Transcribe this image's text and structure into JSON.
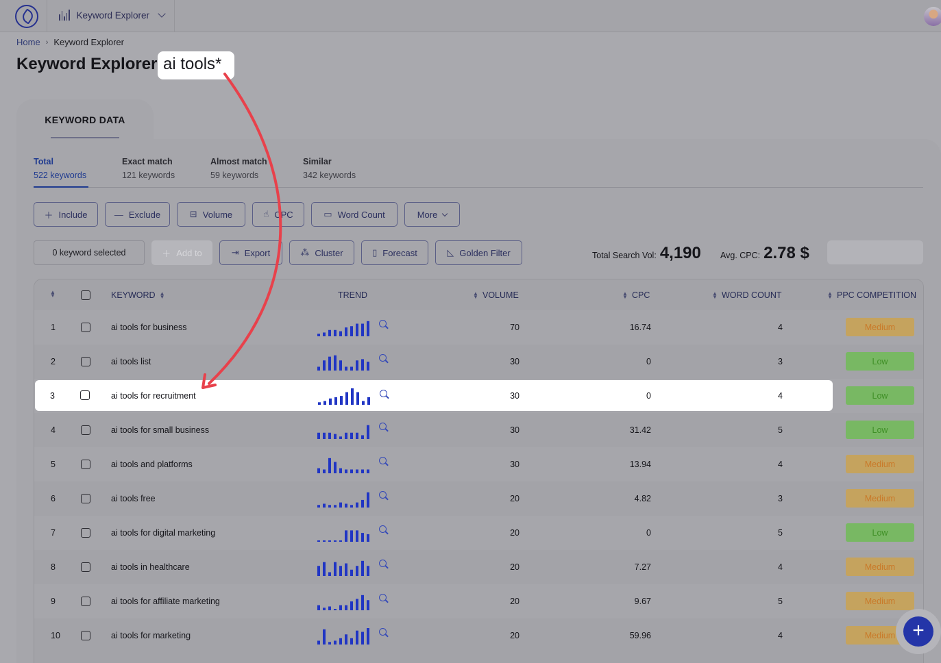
{
  "topbar": {
    "app_name": "Keyword Explorer",
    "icons": {
      "logo": "feather-pen-logo",
      "app": "bar-chart-icon",
      "dropdown": "chevron-down-icon",
      "avatar": "user-avatar"
    }
  },
  "breadcrumb": {
    "home": "Home",
    "separator": "›",
    "current": "Keyword Explorer"
  },
  "title": {
    "prefix": "Keyword Explorer:",
    "query": "ai tools*"
  },
  "panel": {
    "tab_label": "KEYWORD DATA"
  },
  "filter_tabs": [
    {
      "title": "Total",
      "count": "522 keywords",
      "active": true
    },
    {
      "title": "Exact match",
      "count": "121 keywords",
      "active": false
    },
    {
      "title": "Almost match",
      "count": "59 keywords",
      "active": false
    },
    {
      "title": "Similar",
      "count": "342 keywords",
      "active": false
    }
  ],
  "filters": {
    "include": "Include",
    "exclude": "Exclude",
    "volume": "Volume",
    "cpc": "CPC",
    "word_count": "Word Count",
    "more": "More"
  },
  "actions": {
    "selected": "0 keyword selected",
    "add_to": "Add to",
    "export": "Export",
    "cluster": "Cluster",
    "forecast": "Forecast",
    "golden_filter": "Golden Filter"
  },
  "stats": {
    "total_label": "Total Search Vol:",
    "total_value": "4,190",
    "cpc_label": "Avg. CPC:",
    "cpc_value": "2.78 $"
  },
  "table": {
    "headers": {
      "keyword": "KEYWORD",
      "trend": "TREND",
      "volume": "VOLUME",
      "cpc": "CPC",
      "word_count": "WORD COUNT",
      "ppc": "PPC COMPETITION"
    },
    "rows": [
      {
        "n": "1",
        "keyword": "ai tools for business",
        "volume": "70",
        "cpc": "16.74",
        "words": "4",
        "ppc": "Medium",
        "trend": [
          2,
          3,
          5,
          5,
          4,
          7,
          8,
          10,
          10,
          12
        ]
      },
      {
        "n": "2",
        "keyword": "ai tools list",
        "volume": "30",
        "cpc": "0",
        "words": "3",
        "ppc": "Low",
        "trend": [
          3,
          8,
          11,
          12,
          8,
          3,
          3,
          8,
          9,
          7
        ]
      },
      {
        "n": "3",
        "keyword": "ai tools for recruitment",
        "volume": "30",
        "cpc": "0",
        "words": "4",
        "ppc": "Low",
        "trend": [
          2,
          3,
          5,
          6,
          7,
          10,
          13,
          10,
          3,
          6
        ]
      },
      {
        "n": "4",
        "keyword": "ai tools for small business",
        "volume": "30",
        "cpc": "31.42",
        "words": "5",
        "ppc": "Low",
        "trend": [
          5,
          5,
          5,
          4,
          2,
          5,
          5,
          5,
          3,
          11
        ]
      },
      {
        "n": "5",
        "keyword": "ai tools and platforms",
        "volume": "30",
        "cpc": "13.94",
        "words": "4",
        "ppc": "Medium",
        "trend": [
          4,
          3,
          12,
          9,
          4,
          3,
          3,
          3,
          3,
          3
        ]
      },
      {
        "n": "6",
        "keyword": "ai tools free",
        "volume": "20",
        "cpc": "4.82",
        "words": "3",
        "ppc": "Medium",
        "trend": [
          2,
          3,
          2,
          2,
          4,
          3,
          2,
          4,
          6,
          12
        ]
      },
      {
        "n": "7",
        "keyword": "ai tools for digital marketing",
        "volume": "20",
        "cpc": "0",
        "words": "5",
        "ppc": "Low",
        "trend": [
          1,
          1,
          1,
          1,
          1,
          9,
          9,
          9,
          7,
          6
        ]
      },
      {
        "n": "8",
        "keyword": "ai tools in healthcare",
        "volume": "20",
        "cpc": "7.27",
        "words": "4",
        "ppc": "Medium",
        "trend": [
          8,
          11,
          3,
          11,
          8,
          10,
          5,
          8,
          12,
          8
        ]
      },
      {
        "n": "9",
        "keyword": "ai tools for affiliate marketing",
        "volume": "20",
        "cpc": "9.67",
        "words": "5",
        "ppc": "Medium",
        "trend": [
          4,
          2,
          3,
          1,
          4,
          4,
          7,
          9,
          12,
          8
        ]
      },
      {
        "n": "10",
        "keyword": "ai tools for marketing",
        "volume": "20",
        "cpc": "59.96",
        "words": "4",
        "ppc": "Medium",
        "trend": [
          3,
          12,
          2,
          3,
          5,
          8,
          5,
          11,
          10,
          13
        ]
      }
    ]
  },
  "fab": {
    "label": "+"
  },
  "colors": {
    "accent": "#1f3a8f",
    "bar": "#2035c4",
    "arrow": "#e8414b",
    "medium": "#c5a35e",
    "low": "#78b863"
  }
}
